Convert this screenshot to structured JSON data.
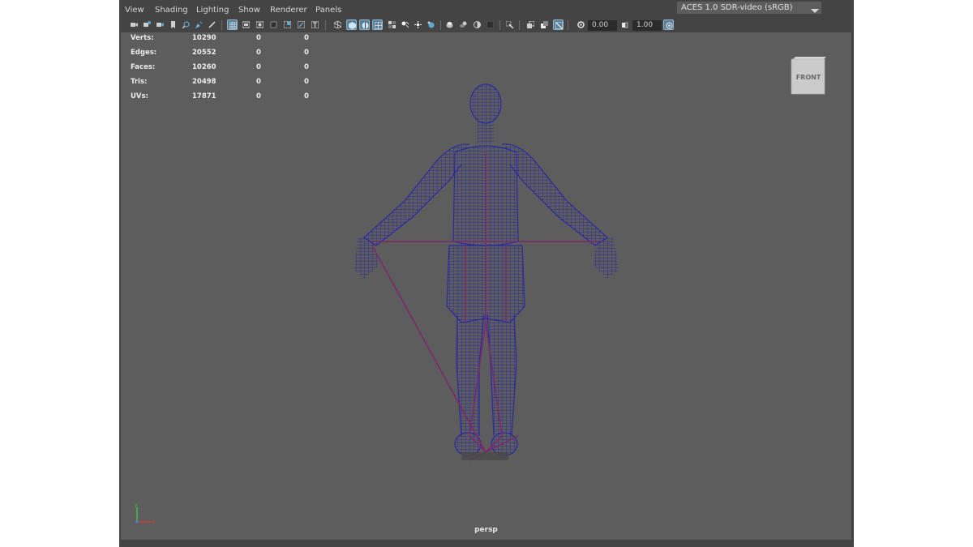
{
  "menu": {
    "items": [
      "View",
      "Shading",
      "Lighting",
      "Show",
      "Renderer",
      "Panels"
    ]
  },
  "toolbar": {
    "exposure_value": "0.00",
    "gamma_value": "1.00",
    "color_space": "ACES 1.0 SDR-video (sRGB)",
    "icons": [
      "camera-select-icon",
      "camera-attributes-icon",
      "bookmark-icon",
      "image-plane-icon",
      "2d-pan-zoom-icon",
      "grease-pencil-icon",
      "grid-icon",
      "film-gate-icon",
      "resolution-gate-icon",
      "gate-mask-icon",
      "field-chart-icon",
      "safe-action-icon",
      "safe-title-icon",
      "wireframe-icon",
      "smooth-shade-icon",
      "shade-wireframe-icon",
      "textured-icon",
      "lighting-icon",
      "shadows-icon",
      "screen-space-ao-icon",
      "motion-blur-icon",
      "multisample-aa-icon",
      "depth-of-field-icon",
      "xray-icon",
      "xray-joints-icon",
      "isolate-select-icon",
      "highlight-icon",
      "exposure-icon",
      "gamma-icon",
      "color-management-icon"
    ]
  },
  "hud": {
    "rows": [
      {
        "label": "Verts:",
        "v1": "10290",
        "v2": "0",
        "v3": "0"
      },
      {
        "label": "Edges:",
        "v1": "20552",
        "v2": "0",
        "v3": "0"
      },
      {
        "label": "Faces:",
        "v1": "10260",
        "v2": "0",
        "v3": "0"
      },
      {
        "label": "Tris:",
        "v1": "20498",
        "v2": "0",
        "v3": "0"
      },
      {
        "label": "UVs:",
        "v1": "17871",
        "v2": "0",
        "v3": "0"
      }
    ]
  },
  "view_cube": {
    "label": "FRONT"
  },
  "camera": {
    "name": "persp"
  },
  "axis": {
    "y": "y",
    "x": "x"
  },
  "colors": {
    "wireframe": "#2a2aa0",
    "skeleton": "#7a2a6a",
    "viewport_bg": "#5d5d5d",
    "toolbar_active": "#5a7f98"
  }
}
